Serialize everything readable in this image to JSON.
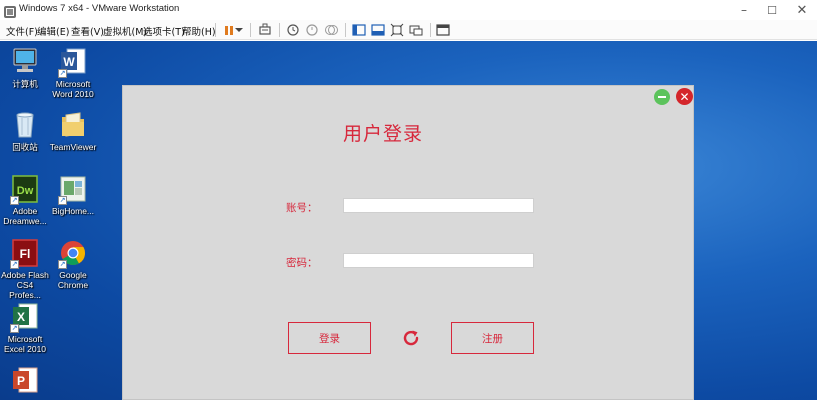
{
  "window": {
    "title": "Windows 7 x64 - VMware Workstation",
    "controls": [
      "–",
      "☐",
      "✕"
    ]
  },
  "menu": [
    "文件(F)",
    "编辑(E)",
    "查看(V)",
    "虚拟机(M)",
    "选项卡(T)",
    "帮助(H)"
  ],
  "toolbar_icons": [
    "pause-icon",
    "dropdown-arrow-icon",
    "send-keys-icon",
    "snapshot-icon",
    "revert-snapshot-icon",
    "manage-snapshots-icon",
    "sidebar-icon",
    "thumbnail-icon",
    "fit-guest-icon",
    "full-screen-icon",
    "unity-icon"
  ],
  "desktop": {
    "icons": [
      {
        "label": "计算机",
        "icon": "computer-icon"
      },
      {
        "label": "Microsoft\nWord 2010",
        "icon": "word-icon"
      },
      {
        "label": "回收站",
        "icon": "recycle-bin-icon"
      },
      {
        "label": "TeamViewer",
        "icon": "folder-icon"
      },
      {
        "label": "Adobe\nDreamwe...",
        "icon": "dreamweaver-icon"
      },
      {
        "label": "BigHome...",
        "icon": "bighome-icon"
      },
      {
        "label": "Adobe Flash\nCS4 Profes...",
        "icon": "flash-icon"
      },
      {
        "label": "Google\nChrome",
        "icon": "chrome-icon"
      },
      {
        "label": "Microsoft\nExcel 2010",
        "icon": "excel-icon"
      },
      {
        "label": "",
        "icon": "powerpoint-icon"
      }
    ]
  },
  "login": {
    "title": "用户登录",
    "account_label": "账号：",
    "password_label": "密码：",
    "account_value": "",
    "password_value": "",
    "login_button": "登录",
    "register_button": "注册",
    "refresh_icon": "refresh-icon",
    "minimize_icon": "minimize-icon",
    "close_icon": "close-icon"
  },
  "colors": {
    "accent": "#d7283c",
    "panel_bg": "#d9d9d9",
    "desktop_bg": "#1b63be"
  }
}
